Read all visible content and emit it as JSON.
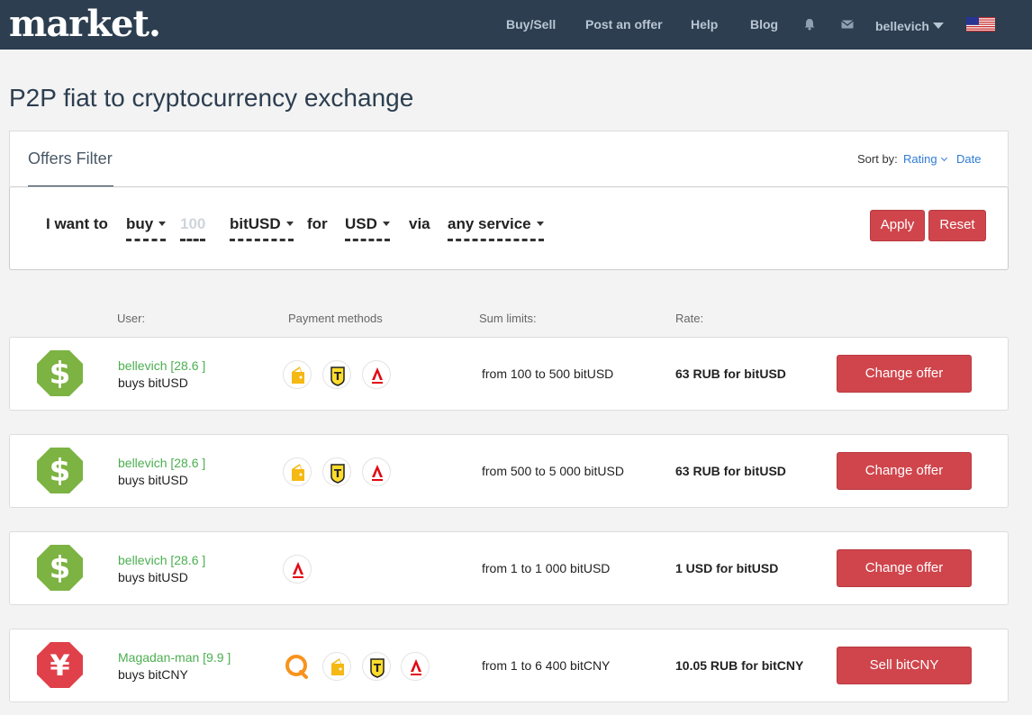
{
  "header": {
    "logo": "market.",
    "nav": [
      "Buy/Sell",
      "Post an offer",
      "Help",
      "Blog"
    ],
    "icons": [
      "bell-icon",
      "envelope-icon"
    ],
    "user": "bellevich",
    "flag": "us-flag-icon"
  },
  "page": {
    "title": "P2P fiat to cryptocurrency exchange"
  },
  "filter": {
    "title": "Offers Filter",
    "sort_label": "Sort by:",
    "sort_options": [
      "Rating",
      "Date"
    ],
    "i_want_to": "I want to",
    "action": "buy",
    "amount": "100",
    "currency": "bitUSD",
    "for_label": "for",
    "fiat": "USD",
    "via_label": "via",
    "service": "any service",
    "apply": "Apply",
    "reset": "Reset"
  },
  "columns": {
    "user": "User:",
    "payment": "Payment methods",
    "limits": "Sum limits:",
    "rate": "Rate:"
  },
  "offers": [
    {
      "icon": "dollar-octagon-icon",
      "user": "bellevich [28.6 ]",
      "action": "buys bitUSD",
      "methods": [
        "yandex-money-icon",
        "tinkoff-icon",
        "alfa-bank-icon"
      ],
      "limits": "from 100 to 500 bitUSD",
      "rate": "63 RUB for bitUSD",
      "button": "Change offer"
    },
    {
      "icon": "dollar-octagon-icon",
      "user": "bellevich [28.6 ]",
      "action": "buys bitUSD",
      "methods": [
        "yandex-money-icon",
        "tinkoff-icon",
        "alfa-bank-icon"
      ],
      "limits": "from 500 to 5 000 bitUSD",
      "rate": "63 RUB for bitUSD",
      "button": "Change offer"
    },
    {
      "icon": "dollar-octagon-icon",
      "user": "bellevich [28.6 ]",
      "action": "buys bitUSD",
      "methods": [
        "alfa-bank-icon"
      ],
      "limits": "from 1 to 1 000 bitUSD",
      "rate": "1 USD for bitUSD",
      "button": "Change offer"
    },
    {
      "icon": "yen-octagon-icon",
      "user": "Magadan-man [9.9 ]",
      "action": "buys bitCNY",
      "methods": [
        "qiwi-icon",
        "yandex-money-icon",
        "tinkoff-icon",
        "alfa-bank-icon"
      ],
      "limits": "from 1 to 6 400 bitCNY",
      "rate": "10.05 RUB for bitCNY",
      "button": "Sell bitCNY"
    }
  ],
  "colors": {
    "header_bg": "#2c3e50",
    "accent_red": "#d0454c",
    "user_green": "#4caf50",
    "link_blue": "#2f7bd4",
    "dollar_green": "#7cb342",
    "yen_red": "#e0404a"
  }
}
